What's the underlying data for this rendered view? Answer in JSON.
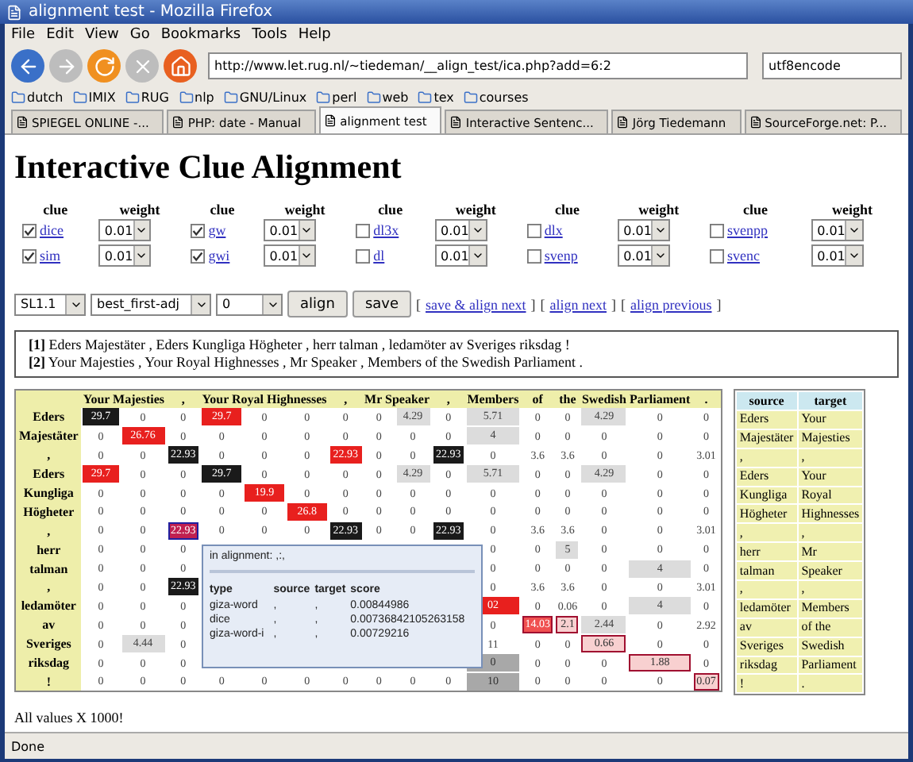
{
  "window": {
    "title": "alignment test - Mozilla Firefox"
  },
  "menu": [
    "File",
    "Edit",
    "View",
    "Go",
    "Bookmarks",
    "Tools",
    "Help"
  ],
  "address": "http://www.let.rug.nl/~tiedeman/__align_test/ica.php?add=6:2",
  "search": "utf8encode",
  "bookmarks": [
    "dutch",
    "IMIX",
    "RUG",
    "nlp",
    "GNU/Linux",
    "perl",
    "web",
    "tex",
    "courses"
  ],
  "tabs": [
    {
      "label": "SPIEGEL ONLINE -...",
      "selected": false
    },
    {
      "label": "PHP: date - Manual",
      "selected": false
    },
    {
      "label": "alignment test",
      "selected": true
    },
    {
      "label": "Interactive Sentenc...",
      "selected": false
    },
    {
      "label": "Jörg Tiedemann",
      "selected": false
    },
    {
      "label": "SourceForge.net: P...",
      "selected": false
    }
  ],
  "page": {
    "heading": "Interactive Clue Alignment",
    "clue_groups": [
      {
        "clue_label": "clue",
        "weight_label": "weight",
        "items": [
          {
            "name": "dice",
            "checked": true,
            "weight": "0.01"
          },
          {
            "name": "sim",
            "checked": true,
            "weight": "0.01"
          }
        ]
      },
      {
        "clue_label": "clue",
        "weight_label": "weight",
        "items": [
          {
            "name": "gw",
            "checked": true,
            "weight": "0.01"
          },
          {
            "name": "gwi",
            "checked": true,
            "weight": "0.01"
          }
        ]
      },
      {
        "clue_label": "clue",
        "weight_label": "weight",
        "items": [
          {
            "name": "dl3x",
            "checked": false,
            "weight": "0.01"
          },
          {
            "name": "dl",
            "checked": false,
            "weight": "0.01"
          }
        ]
      },
      {
        "clue_label": "clue",
        "weight_label": "weight",
        "items": [
          {
            "name": "dlx",
            "checked": false,
            "weight": "0.01"
          },
          {
            "name": "svenp",
            "checked": false,
            "weight": "0.01"
          }
        ]
      },
      {
        "clue_label": "clue",
        "weight_label": "weight",
        "items": [
          {
            "name": "svenpp",
            "checked": false,
            "weight": "0.01"
          },
          {
            "name": "svenc",
            "checked": false,
            "weight": "0.01"
          }
        ]
      }
    ],
    "selects": [
      "SL1.1",
      "best_first-adj",
      "0"
    ],
    "buttons": [
      "align",
      "save"
    ],
    "links": [
      {
        "open": "[",
        "label": "save & align next",
        "close": "]"
      },
      {
        "open": "[",
        "label": "align next",
        "close": "]"
      },
      {
        "open": "[",
        "label": "align previous",
        "close": "]"
      }
    ],
    "sentences": [
      "**[1]** Eders Majestäter , Eders Kungliga Högheter , herr talman , ledamöter av Sveriges riksdag !",
      "**[2]** Your Majesties , Your Royal Highnesses , Mr Speaker , Members of the Swedish Parliament ."
    ],
    "matrix": {
      "column_groups": [
        {
          "words": [
            "Your",
            "Majesties"
          ]
        },
        {
          "words": [
            ","
          ]
        },
        {
          "words": [
            "Your",
            "Royal",
            "Highnesses"
          ]
        },
        {
          "words": [
            ","
          ]
        },
        {
          "words": [
            "Mr",
            "Speaker"
          ]
        },
        {
          "words": [
            ","
          ]
        },
        {
          "words": [
            "Members"
          ]
        },
        {
          "words": [
            "of"
          ]
        },
        {
          "words": [
            "the"
          ]
        },
        {
          "words": [
            "Swedish"
          ]
        },
        {
          "words": [
            "Parliament"
          ]
        },
        {
          "words": [
            "."
          ]
        }
      ],
      "rows": [
        {
          "label": "Eders",
          "cells": [
            {
              "text": "29.7",
              "kind": "black"
            },
            "0",
            "0",
            {
              "text": "29.7",
              "kind": "red"
            },
            "0",
            "0",
            "0",
            "0",
            {
              "text": "4.29",
              "kind": "grey"
            },
            "0",
            {
              "text": "5.71",
              "kind": "grey"
            },
            "0",
            "0",
            {
              "text": "4.29",
              "kind": "grey"
            },
            "0",
            "0"
          ]
        },
        {
          "label": "Majestäter",
          "cells": [
            "0",
            {
              "text": "26.76",
              "kind": "red"
            },
            "0",
            "0",
            "0",
            "0",
            "0",
            "0",
            "0",
            "0",
            {
              "text": "4",
              "kind": "grey"
            },
            "0",
            "0",
            "0",
            "0",
            "0"
          ]
        },
        {
          "label": ",",
          "cells": [
            "0",
            "0",
            {
              "text": "22.93",
              "kind": "black"
            },
            "0",
            "0",
            "0",
            {
              "text": "22.93",
              "kind": "red"
            },
            "0",
            "0",
            {
              "text": "22.93",
              "kind": "black"
            },
            "0",
            "3.6",
            "3.6",
            "0",
            "0",
            "3.01"
          ]
        },
        {
          "label": "Eders",
          "cells": [
            {
              "text": "29.7",
              "kind": "red"
            },
            "0",
            "0",
            {
              "text": "29.7",
              "kind": "black"
            },
            "0",
            "0",
            "0",
            "0",
            {
              "text": "4.29",
              "kind": "grey"
            },
            "0",
            {
              "text": "5.71",
              "kind": "grey"
            },
            "0",
            "0",
            {
              "text": "4.29",
              "kind": "grey"
            },
            "0",
            "0"
          ]
        },
        {
          "label": "Kungliga",
          "cells": [
            "0",
            "0",
            "0",
            "0",
            {
              "text": "19.9",
              "kind": "red"
            },
            "0",
            "0",
            "0",
            "0",
            "0",
            "0",
            "0",
            "0",
            "0",
            "0",
            "0"
          ]
        },
        {
          "label": "Högheter",
          "cells": [
            "0",
            "0",
            "0",
            "0",
            "0",
            {
              "text": "26.8",
              "kind": "red"
            },
            "0",
            "0",
            "0",
            "0",
            "0",
            "0",
            "0",
            "0",
            "0",
            "0"
          ]
        },
        {
          "label": ",",
          "cells": [
            "0",
            "0",
            {
              "text": "22.93",
              "kind": "chosen"
            },
            "0",
            "0",
            "0",
            {
              "text": "22.93",
              "kind": "black"
            },
            "0",
            "0",
            {
              "text": "22.93",
              "kind": "black"
            },
            "0",
            "3.6",
            "3.6",
            "0",
            "0",
            "3.01"
          ]
        },
        {
          "label": "herr",
          "cells": [
            "0",
            "0",
            "0",
            null,
            null,
            null,
            null,
            null,
            null,
            null,
            "0",
            "0",
            {
              "text": "5",
              "kind": "grey"
            },
            "0",
            "0",
            "0"
          ]
        },
        {
          "label": "talman",
          "cells": [
            "0",
            "0",
            "0",
            null,
            null,
            null,
            null,
            null,
            null,
            null,
            "0",
            "0",
            "0",
            "0",
            {
              "text": "4",
              "kind": "grey"
            },
            "0"
          ]
        },
        {
          "label": ",",
          "cells": [
            "0",
            "0",
            {
              "text": "22.93",
              "kind": "black"
            },
            null,
            null,
            null,
            null,
            null,
            null,
            null,
            "0",
            "3.6",
            "3.6",
            "0",
            "0",
            "3.01"
          ]
        },
        {
          "label": "ledamöter",
          "cells": [
            "0",
            "0",
            "0",
            null,
            null,
            null,
            null,
            null,
            null,
            null,
            {
              "text": "02",
              "kind": "red"
            },
            "0",
            "0.06",
            "0",
            {
              "text": "4",
              "kind": "grey"
            },
            "0"
          ]
        },
        {
          "label": "av",
          "cells": [
            "0",
            "0",
            "0",
            null,
            null,
            null,
            null,
            null,
            null,
            null,
            "0",
            {
              "text": "14.03",
              "kind": "red-outlined"
            },
            {
              "text": "2.1",
              "kind": "outlined"
            },
            {
              "text": "2.44",
              "kind": "grey"
            },
            "0",
            "2.92"
          ]
        },
        {
          "label": "Sveriges",
          "cells": [
            "0",
            {
              "text": "4.44",
              "kind": "grey"
            },
            "0",
            null,
            null,
            null,
            null,
            null,
            null,
            null,
            "11",
            "0",
            "0",
            {
              "text": "0.66",
              "kind": "outlined"
            },
            "0",
            "0"
          ]
        },
        {
          "label": "riksdag",
          "cells": [
            "0",
            "0",
            "0",
            null,
            null,
            null,
            null,
            null,
            null,
            null,
            {
              "text": "0",
              "kind": "darkgrey"
            },
            "0",
            "0",
            "0",
            {
              "text": "1.88",
              "kind": "outlined"
            },
            "0"
          ]
        },
        {
          "label": "!",
          "cells": [
            "0",
            "0",
            "0",
            "0",
            "0",
            "0",
            "0",
            "0",
            "0",
            "0",
            {
              "text": "10",
              "kind": "darkgrey"
            },
            "0",
            "0",
            "0",
            "0",
            {
              "text": "0.07",
              "kind": "outlined"
            }
          ]
        }
      ]
    },
    "tooltip": {
      "title": "in alignment: ,:,",
      "columns": [
        "type",
        "source",
        "target",
        "score"
      ],
      "rows": [
        [
          "giza-word",
          ",",
          ",",
          "0.00844986"
        ],
        [
          "dice",
          ",",
          ",",
          "0.00736842105263158"
        ],
        [
          "giza-word-i",
          ",",
          ",",
          "0.00729216"
        ]
      ]
    },
    "alignment": {
      "columns": [
        "source",
        "target"
      ],
      "rows": [
        [
          "Eders",
          "Your"
        ],
        [
          "Majestäter",
          "Majesties"
        ],
        [
          ",",
          ","
        ],
        [
          "Eders",
          "Your"
        ],
        [
          "Kungliga",
          "Royal"
        ],
        [
          "Högheter",
          "Highnesses"
        ],
        [
          ",",
          ","
        ],
        [
          "herr",
          "Mr"
        ],
        [
          "talman",
          "Speaker"
        ],
        [
          ",",
          ","
        ],
        [
          "ledamöter",
          "Members"
        ],
        [
          "av",
          "of the"
        ],
        [
          "Sveriges",
          "Swedish"
        ],
        [
          "riksdag",
          "Parliament"
        ],
        [
          "!",
          "."
        ]
      ]
    },
    "footer": "All values X 1000!"
  },
  "status_bar": "Done"
}
